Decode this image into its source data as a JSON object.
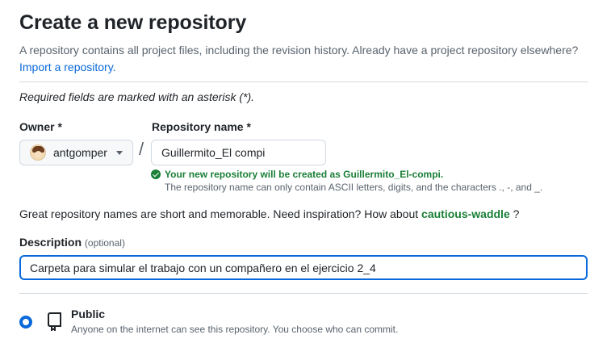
{
  "page": {
    "title": "Create a new repository",
    "intro_text": "A repository contains all project files, including the revision history. Already have a project repository elsewhere?",
    "import_link": "Import a repository.",
    "required_note": "Required fields are marked with an asterisk (*)."
  },
  "owner": {
    "label": "Owner *",
    "value": "antgomper"
  },
  "separator": "/",
  "repository_name": {
    "label": "Repository name *",
    "value": "Guillermito_El compi",
    "validation": "Your new repository will be created as Guillermito_El-compi.",
    "hint": "The repository name can only contain ASCII letters, digits, and the characters ., -, and _."
  },
  "inspiration": {
    "text": "Great repository names are short and memorable. Need inspiration? How about",
    "suggestion": "cautious-waddle",
    "end": "?"
  },
  "description": {
    "label": "Description",
    "optional": "(optional)",
    "value": "Carpeta para simular el trabajo con un compañero en el ejercicio 2_4"
  },
  "visibility": {
    "public_label": "Public",
    "public_desc": "Anyone on the internet can see this repository. You choose who can commit.",
    "selected": "public"
  },
  "colors": {
    "accent": "#0969da",
    "success": "#1a7f37",
    "muted": "#59636e"
  },
  "icons": {
    "owner_avatar": "avatar",
    "caret": "triangle-down-icon",
    "valid": "check-circle-fill-icon",
    "public": "repo-icon"
  }
}
